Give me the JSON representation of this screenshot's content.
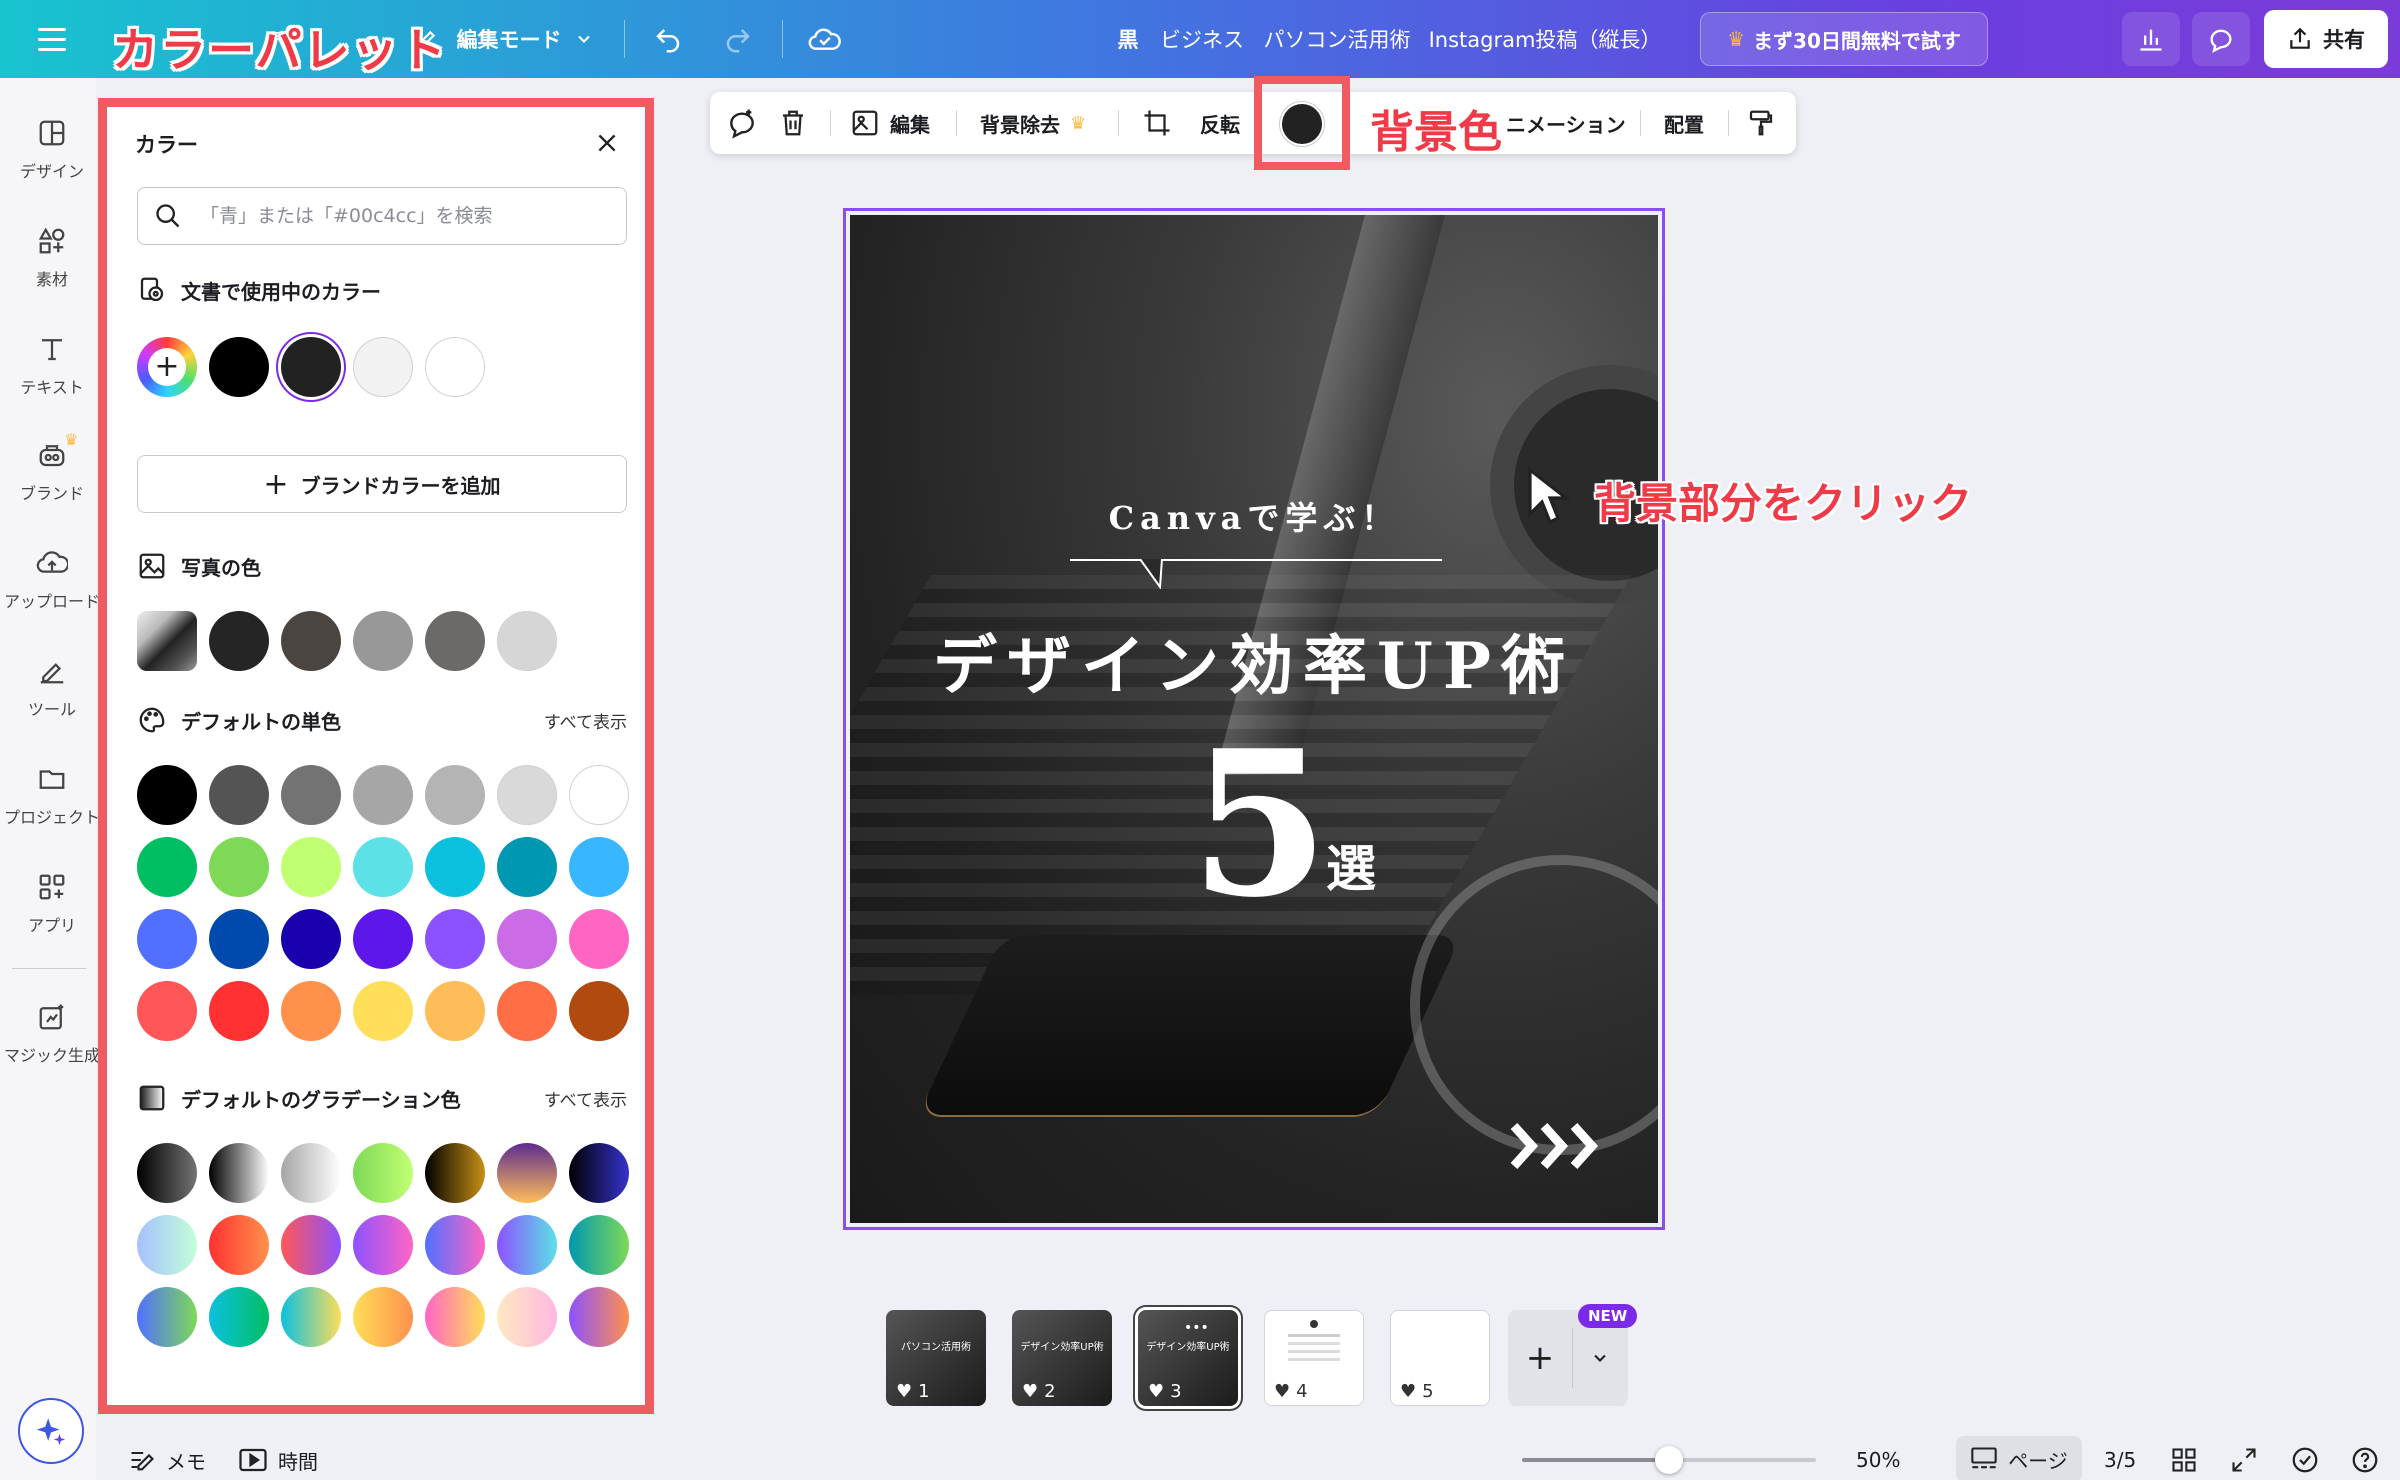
{
  "topbar": {
    "mode_label": "編集モード",
    "breadcrumbs": [
      "黒",
      "ビジネス",
      "パソコン活用術",
      "Instagram投稿（縦長）"
    ],
    "trial_button": "まず30日間無料で試す",
    "share_button": "共有"
  },
  "annotations": {
    "panel_title": "カラーパレット",
    "bg_color": "背景色",
    "click_bg": "背景部分をクリック"
  },
  "rail": {
    "items": [
      {
        "label": "デザイン",
        "icon": "design-icon"
      },
      {
        "label": "素材",
        "icon": "elements-icon"
      },
      {
        "label": "テキスト",
        "icon": "text-icon"
      },
      {
        "label": "ブランド",
        "icon": "brand-icon"
      },
      {
        "label": "アップロード",
        "icon": "upload-icon"
      },
      {
        "label": "ツール",
        "icon": "draw-icon"
      },
      {
        "label": "プロジェクト",
        "icon": "folder-icon"
      },
      {
        "label": "アプリ",
        "icon": "apps-icon"
      },
      {
        "label": "マジック生成",
        "icon": "magic-icon"
      }
    ]
  },
  "panel": {
    "title": "カラー",
    "search_placeholder": "「青」または「#00c4cc」を検索",
    "doc_colors_title": "文書で使用中のカラー",
    "doc_colors": [
      "#000000",
      "#222222",
      "#f2f2f2",
      "#ffffff"
    ],
    "brand_button": "ブランドカラーを追加",
    "photo_colors_title": "写真の色",
    "photo_colors": [
      "#252525",
      "#4a4541",
      "#989898",
      "#6b6a69",
      "#d6d6d6"
    ],
    "default_solid_title": "デフォルトの単色",
    "show_all": "すべて表示",
    "default_solid": [
      [
        "#000000",
        "#545454",
        "#737373",
        "#a6a6a6",
        "#b4b4b4",
        "#d9d9d9",
        "#ffffff"
      ],
      [
        "#00bf63",
        "#7ed957",
        "#c1ff72",
        "#5ce1e6",
        "#0cc0df",
        "#0097b2",
        "#38b6ff"
      ],
      [
        "#5170ff",
        "#004aad",
        "#1800ad",
        "#5e17eb",
        "#8c52ff",
        "#cb6ce6",
        "#ff66c4"
      ],
      [
        "#ff5757",
        "#ff3131",
        "#ff914d",
        "#ffde59",
        "#ffbd59",
        "#ff6e44",
        "#b04a0e"
      ]
    ],
    "default_gradient_title": "デフォルトのグラデーション色",
    "default_gradients": [
      [
        "linear-gradient(90deg,#000,#737373)",
        "linear-gradient(90deg,#000,#fff)",
        "linear-gradient(90deg,#a6a6a6,#fff)",
        "linear-gradient(90deg,#7ed957,#c1ff72)",
        "linear-gradient(90deg,#000,#c89116)",
        "linear-gradient(180deg,#5d2c8f,#ffbd59)",
        "linear-gradient(90deg,#000,#3533cd)"
      ],
      [
        "linear-gradient(90deg,#a6c0fe,#c2ffd8)",
        "linear-gradient(90deg,#ff3131,#ff914d)",
        "linear-gradient(90deg,#ff5757,#8c52ff)",
        "linear-gradient(90deg,#8c52ff,#ff66c4)",
        "linear-gradient(90deg,#5170ff,#ff66c4)",
        "linear-gradient(90deg,#8c52ff,#5ce1e6)",
        "linear-gradient(90deg,#0097b2,#7ed957)"
      ],
      [
        "linear-gradient(90deg,#5170ff,#7ed957)",
        "linear-gradient(90deg,#0cc0df,#00bf63)",
        "linear-gradient(90deg,#0cc0df,#ffde59)",
        "linear-gradient(90deg,#ffde59,#ff914d)",
        "linear-gradient(90deg,#ff66c4,#ffde59)",
        "linear-gradient(90deg,#ffe9c2,#ffb8e1)",
        "linear-gradient(90deg,#8c52ff,#ff914d)"
      ]
    ]
  },
  "toolbar": {
    "edit": "編集",
    "bg_remove": "背景除去",
    "flip": "反転",
    "animate": "ニメーション",
    "position": "配置",
    "bg_color_value": "#222222"
  },
  "page": {
    "subtitle": "Canvaで学ぶ！",
    "title": "デザイン効率UP術",
    "number": "5",
    "suffix": "選"
  },
  "thumbnails": [
    {
      "num": "1",
      "caption": "パソコン活用術"
    },
    {
      "num": "2",
      "caption": "デザイン効率UP術"
    },
    {
      "num": "3",
      "caption": "デザイン効率UP術"
    },
    {
      "num": "4",
      "caption": ""
    },
    {
      "num": "5",
      "caption": ""
    }
  ],
  "new_badge": "NEW",
  "bottombar": {
    "memo": "メモ",
    "time": "時間",
    "zoom": "50%",
    "zoom_level": 0.5,
    "pages_label": "ページ",
    "page_counter": "3/5"
  }
}
